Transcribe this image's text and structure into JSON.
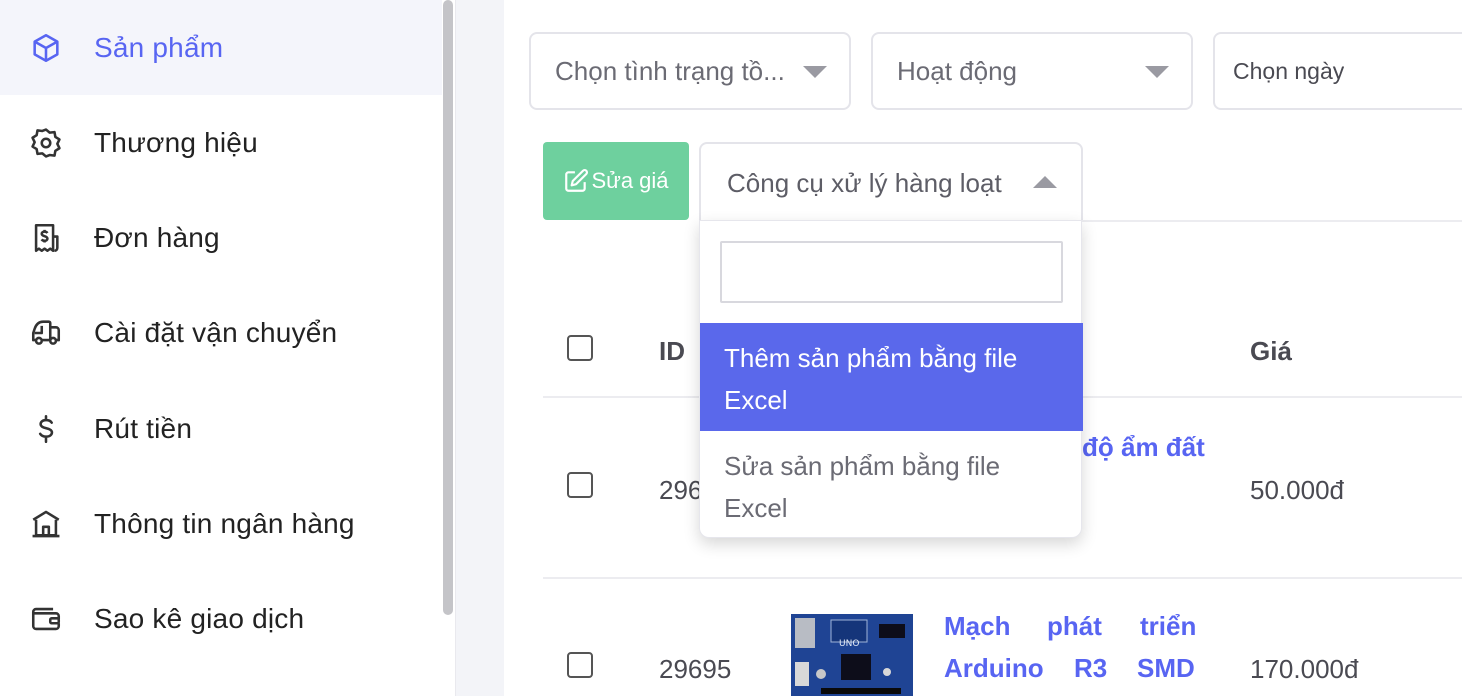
{
  "sidebar": {
    "items": [
      {
        "label": "Sản phẩm",
        "icon": "cube-icon",
        "active": true
      },
      {
        "label": "Thương hiệu",
        "icon": "badge-icon"
      },
      {
        "label": "Đơn hàng",
        "icon": "receipt-dollar-icon"
      },
      {
        "label": "Cài đặt vận chuyển",
        "icon": "truck-icon"
      },
      {
        "label": "Rút tiền",
        "icon": "dollar-icon"
      },
      {
        "label": "Thông tin ngân hàng",
        "icon": "bank-icon"
      },
      {
        "label": "Sao kê giao dịch",
        "icon": "wallet-icon"
      }
    ]
  },
  "filters": {
    "stock_status": "Chọn tình trạng tồ...",
    "activity": "Hoạt động",
    "date": "Chọn ngày"
  },
  "toolbar": {
    "edit_price_label": "Sửa giá",
    "bulk_tools_label": "Công cụ xử lý hàng loạt"
  },
  "bulk_dropdown": {
    "search_value": "",
    "options": [
      {
        "label": "Thêm sản phẩm bằng file Excel",
        "selected": true
      },
      {
        "label": "Sửa sản phẩm bằng file Excel",
        "selected": false
      }
    ]
  },
  "table": {
    "headers": {
      "id": "ID",
      "price": "Giá"
    },
    "rows": [
      {
        "id": "296",
        "name_fragment": "độ ẩm đất",
        "price": "50.000đ"
      },
      {
        "id": "29695",
        "name_line1": [
          "Mạch",
          "phát",
          "triển"
        ],
        "name_line2": [
          "Arduino",
          "R3",
          "SMD"
        ],
        "price": "170.000đ"
      }
    ]
  },
  "colors": {
    "accent": "#5865f2",
    "selected_option": "#5a68eb",
    "edit_button": "#6ed09e"
  }
}
